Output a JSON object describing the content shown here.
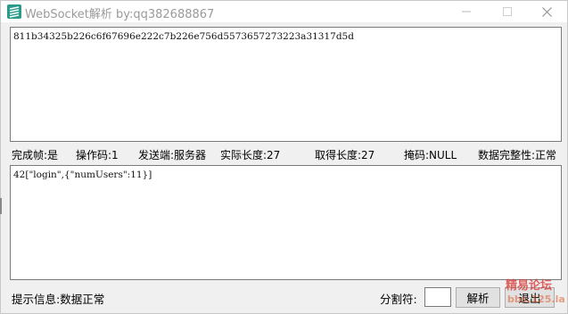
{
  "window": {
    "title": "WebSocket解析   by:qq382688867"
  },
  "input": {
    "hex_value": "811b34325b226c6f67696e222c7b226e756d5573657273223a31317d5d"
  },
  "status": {
    "finish_frame": "完成帧:是",
    "opcode": "操作码:1",
    "sender": "发送端:服务器",
    "actual_length": "实际长度:27",
    "obtained_length": "取得长度:27",
    "mask": "掩码:NULL",
    "integrity": "数据完整性:正常"
  },
  "output": {
    "decoded_value": "42[\"login\",{\"numUsers\":11}]"
  },
  "footer": {
    "hint": "提示信息:数据正常",
    "separator_label": "分割符:",
    "separator_value": "",
    "parse_label": "解析",
    "exit_label": "退出"
  },
  "watermark": {
    "line1": "精易论坛",
    "line2": "bbs.125.la"
  }
}
